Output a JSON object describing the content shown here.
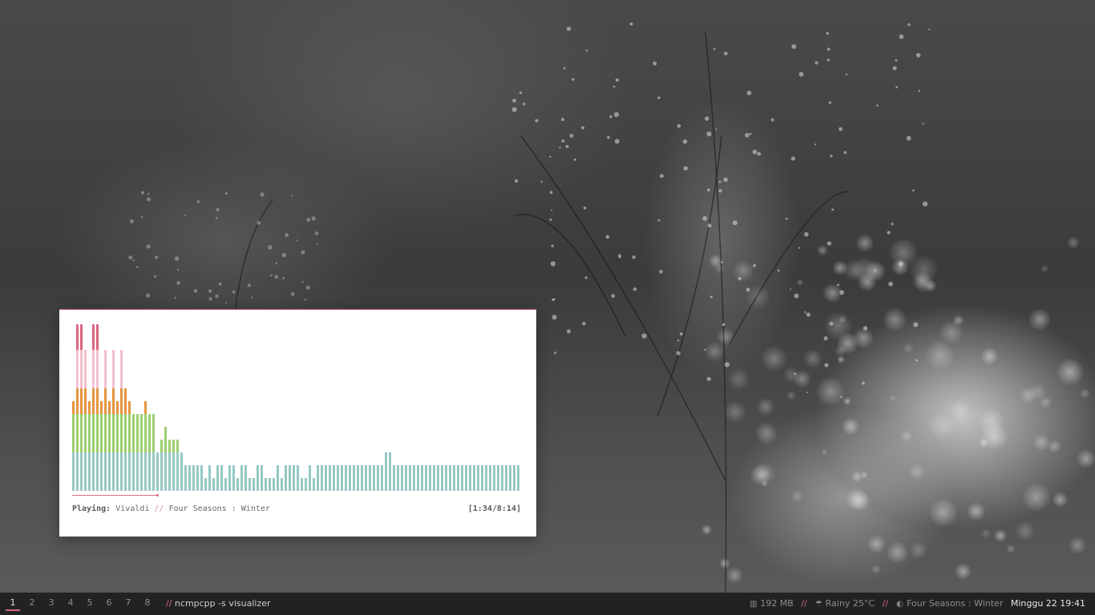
{
  "colors": {
    "accent": "#d46a80",
    "bar_red": "#dc6680",
    "bar_pink": "#f4c0cc",
    "bar_orange": "#e6953e",
    "bar_green": "#9ccf72",
    "bar_teal": "#96c8c2",
    "panel_bg": "#222222",
    "window_bg": "#ffffff"
  },
  "player": {
    "playing_label": "Playing:",
    "artist": "Vivaldi",
    "separator": "//",
    "track": "Four Seasons : Winter",
    "time": "[1:34/8:14]",
    "progress_fraction": 0.19
  },
  "visualizer": {
    "column_levels": [
      7,
      13,
      13,
      11,
      7,
      13,
      13,
      7,
      11,
      7,
      11,
      7,
      11,
      8,
      7,
      6,
      6,
      6,
      7,
      6,
      6,
      3,
      4,
      5,
      4,
      4,
      4,
      3,
      2,
      2,
      2,
      2,
      2,
      1,
      2,
      1,
      2,
      2,
      1,
      2,
      2,
      1,
      2,
      2,
      1,
      1,
      2,
      2,
      1,
      1,
      1,
      2,
      1,
      2,
      2,
      2,
      2,
      1,
      1,
      2,
      1,
      2,
      2,
      2,
      2,
      2,
      2,
      2,
      2,
      2,
      2,
      2,
      2,
      2,
      2,
      2,
      2,
      2,
      3,
      3,
      2,
      2,
      2,
      2,
      2,
      2,
      2,
      2,
      2,
      2,
      2,
      2,
      2,
      2,
      2,
      2,
      2,
      2,
      2,
      2,
      2,
      2,
      2,
      2,
      2,
      2,
      2,
      2,
      2,
      2,
      2,
      2
    ],
    "level_colors": [
      "#96c8c2",
      "#96c8c2",
      "#96c8c2",
      "#9ccf72",
      "#9ccf72",
      "#9ccf72",
      "#e6953e",
      "#e6953e",
      "#f4c0cc",
      "#f4c0cc",
      "#f4c0cc",
      "#dc6680",
      "#dc6680"
    ]
  },
  "panel": {
    "workspaces": [
      "1",
      "2",
      "3",
      "4",
      "5",
      "6",
      "7",
      "8"
    ],
    "active_workspace": "1",
    "separator": "//",
    "window_title": "ncmpcpp -s visualizer",
    "memory_icon": "memory-icon",
    "memory": "192 MB",
    "weather_icon": "umbrella-icon",
    "weather": "Rainy 25°C",
    "music_icon": "toggle-icon",
    "now_playing": "Four Seasons : Winter",
    "date": "Minggu 22",
    "time": "19:41"
  }
}
